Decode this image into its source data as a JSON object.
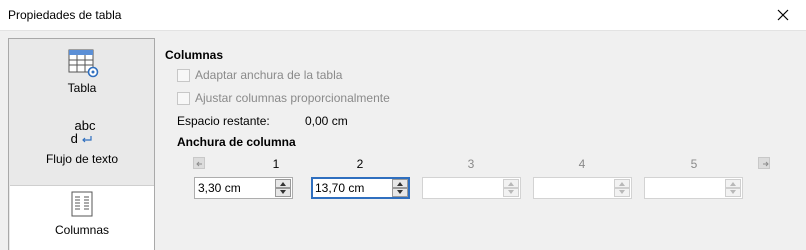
{
  "window": {
    "title": "Propiedades de tabla"
  },
  "sidebar": {
    "items": [
      {
        "label": "Tabla",
        "icon": "table-properties-icon"
      },
      {
        "label": "Flujo de texto",
        "icon": "text-flow-icon",
        "glyph_top": "abc",
        "glyph_bottom": "d"
      },
      {
        "label": "Columnas",
        "icon": "columns-icon",
        "active": true
      }
    ]
  },
  "columns": {
    "section_title": "Columnas",
    "fit_width_label": "Adaptar anchura de la tabla",
    "adjust_prop_label": "Ajustar columnas proporcionalmente",
    "remaining_label": "Espacio restante:",
    "remaining_value": "0,00 cm"
  },
  "width": {
    "section_title": "Anchura de columna",
    "headers": [
      "1",
      "2",
      "3",
      "4",
      "5"
    ],
    "values": [
      "3,30 cm",
      "13,70 cm",
      "",
      "",
      ""
    ]
  },
  "colors": {
    "accent": "#2f6fbf",
    "disabled_text": "#8a8a8a"
  }
}
